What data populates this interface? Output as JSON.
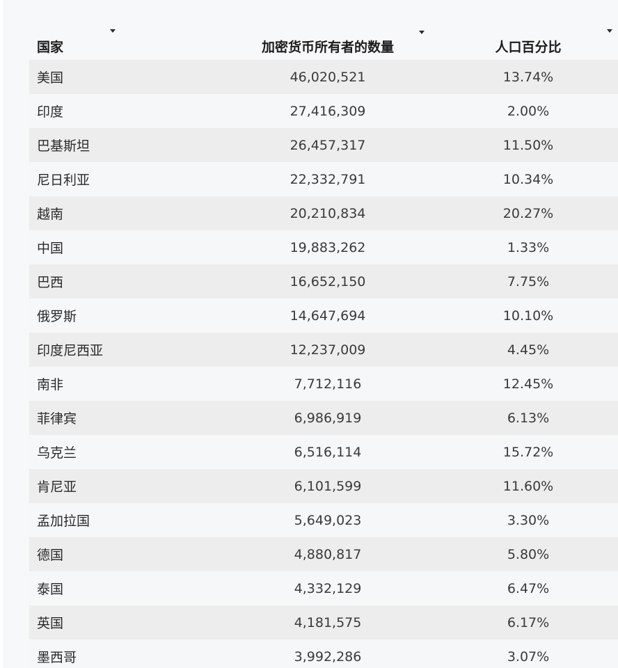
{
  "table": {
    "headers": {
      "country": "国家",
      "owners": "加密货币所有者的数量",
      "percent": "人口百分比"
    },
    "rows": [
      {
        "country": "美国",
        "owners": "46,020,521",
        "percent": "13.74%"
      },
      {
        "country": "印度",
        "owners": "27,416,309",
        "percent": "2.00%"
      },
      {
        "country": "巴基斯坦",
        "owners": "26,457,317",
        "percent": "11.50%"
      },
      {
        "country": "尼日利亚",
        "owners": "22,332,791",
        "percent": "10.34%"
      },
      {
        "country": "越南",
        "owners": "20,210,834",
        "percent": "20.27%"
      },
      {
        "country": "中国",
        "owners": "19,883,262",
        "percent": "1.33%"
      },
      {
        "country": "巴西",
        "owners": "16,652,150",
        "percent": "7.75%"
      },
      {
        "country": "俄罗斯",
        "owners": "14,647,694",
        "percent": "10.10%"
      },
      {
        "country": "印度尼西亚",
        "owners": "12,237,009",
        "percent": "4.45%"
      },
      {
        "country": "南非",
        "owners": "7,712,116",
        "percent": "12.45%"
      },
      {
        "country": "菲律宾",
        "owners": "6,986,919",
        "percent": "6.13%"
      },
      {
        "country": "乌克兰",
        "owners": "6,516,114",
        "percent": "15.72%"
      },
      {
        "country": "肯尼亚",
        "owners": "6,101,599",
        "percent": "11.60%"
      },
      {
        "country": "孟加拉国",
        "owners": "5,649,023",
        "percent": "3.30%"
      },
      {
        "country": "德国",
        "owners": "4,880,817",
        "percent": "5.80%"
      },
      {
        "country": "泰国",
        "owners": "4,332,129",
        "percent": "6.47%"
      },
      {
        "country": "英国",
        "owners": "4,181,575",
        "percent": "6.17%"
      },
      {
        "country": "墨西哥",
        "owners": "3,992,286",
        "percent": "3.07%"
      }
    ]
  },
  "icons": {
    "sort": "sort-caret-down-icon"
  }
}
